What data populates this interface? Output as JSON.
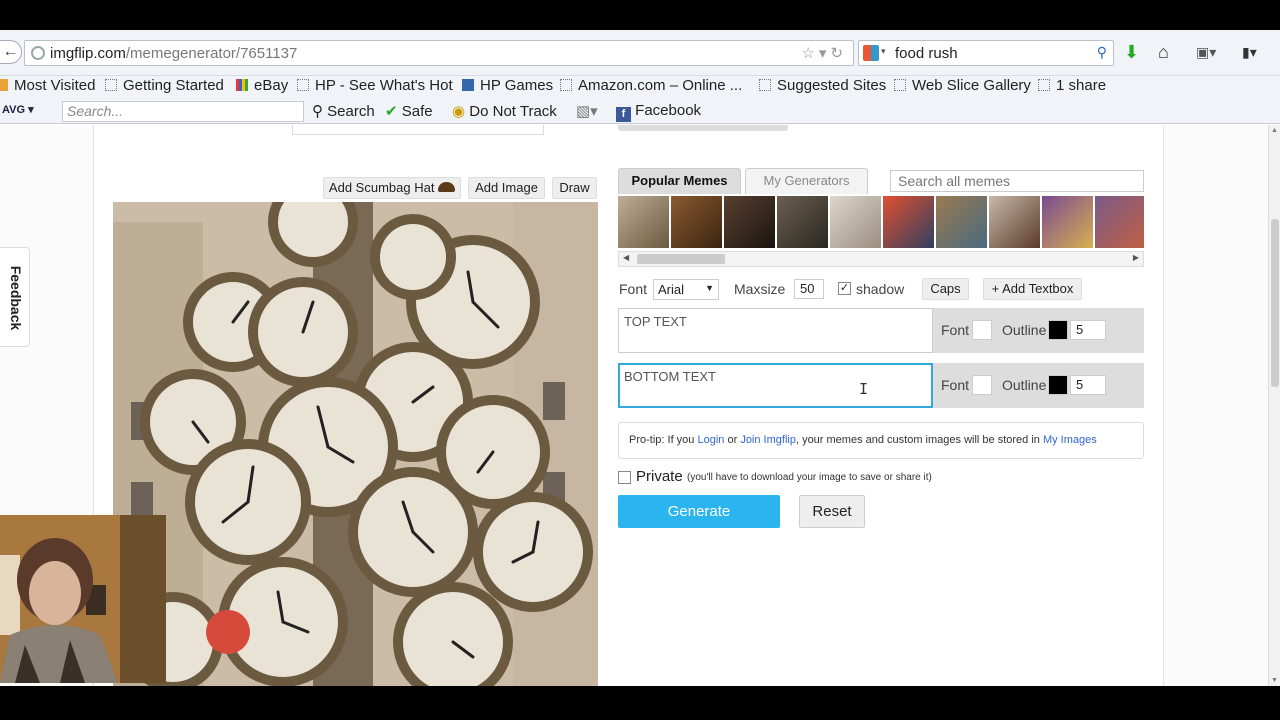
{
  "browser": {
    "url_domain": "imgflip.com",
    "url_path": "/memegenerator/7651137",
    "search_value": "food rush",
    "bookmarks": [
      "Most Visited",
      "Getting Started",
      "eBay",
      "HP - See What's Hot",
      "HP Games",
      "Amazon.com – Online ...",
      "Suggested Sites",
      "Web Slice Gallery",
      "1 share"
    ],
    "avg": {
      "logo": "AVG",
      "search_placeholder": "Search...",
      "search_label": "Search",
      "safe_label": "Safe",
      "dnt_label": "Do Not Track",
      "facebook_label": "Facebook"
    }
  },
  "editor": {
    "add_scumbag_hat": "Add Scumbag Hat",
    "add_image": "Add Image",
    "draw": "Draw"
  },
  "panel": {
    "tabs": [
      "Popular Memes",
      "My Generators"
    ],
    "search_placeholder": "Search all memes",
    "font_label": "Font",
    "font_value": "Arial",
    "maxsize_label": "Maxsize",
    "maxsize_value": "50",
    "shadow_label": "shadow",
    "caps_label": "Caps",
    "add_textbox_label": "+ Add Textbox",
    "text_boxes": [
      {
        "placeholder": "TOP TEXT",
        "font_label": "Font",
        "outline_label": "Outline",
        "outline_value": "5"
      },
      {
        "placeholder": "BOTTOM TEXT",
        "font_label": "Font",
        "outline_label": "Outline",
        "outline_value": "5"
      }
    ],
    "protip_prefix": "Pro-tip: If you",
    "protip_login": "Login",
    "protip_or": "or",
    "protip_join": "Join Imgflip",
    "protip_middle": ", your memes and custom images will be stored in",
    "protip_myimages": "My Images",
    "private_label": "Private",
    "private_note": "(you'll have to download your image to save or share it)",
    "generate_label": "Generate",
    "reset_label": "Reset"
  },
  "feedback_label": "Feedback",
  "colors": {
    "accent": "#2bb5ee",
    "link": "#3366cc"
  }
}
